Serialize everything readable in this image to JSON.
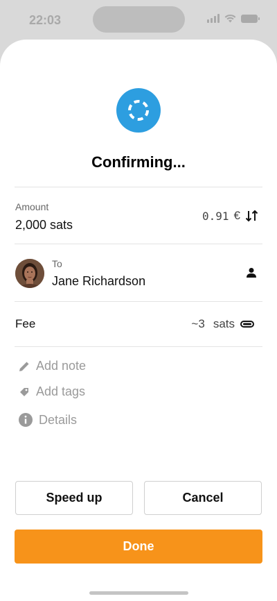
{
  "status_bar": {
    "time": "22:03"
  },
  "sheet": {
    "title": "Confirming...",
    "amount": {
      "label": "Amount",
      "value": "2,000 sats",
      "fiat_value": "0.91",
      "fiat_currency": "€"
    },
    "recipient": {
      "label": "To",
      "name": "Jane Richardson"
    },
    "fee": {
      "label": "Fee",
      "value": "~3",
      "unit": "sats"
    },
    "actions": {
      "add_note": "Add note",
      "add_tags": "Add tags",
      "details": "Details"
    },
    "buttons": {
      "speed_up": "Speed up",
      "cancel": "Cancel",
      "done": "Done"
    }
  },
  "colors": {
    "spinner_bg": "#2d9ee0",
    "done_button": "#f7931a",
    "muted_text": "#9a9a9a"
  },
  "icons": [
    "signal-icon",
    "wifi-icon",
    "battery-icon",
    "spinner-icon",
    "swap-arrows-icon",
    "contact-icon",
    "fee-rate-icon",
    "pencil-icon",
    "tag-icon",
    "info-icon"
  ]
}
